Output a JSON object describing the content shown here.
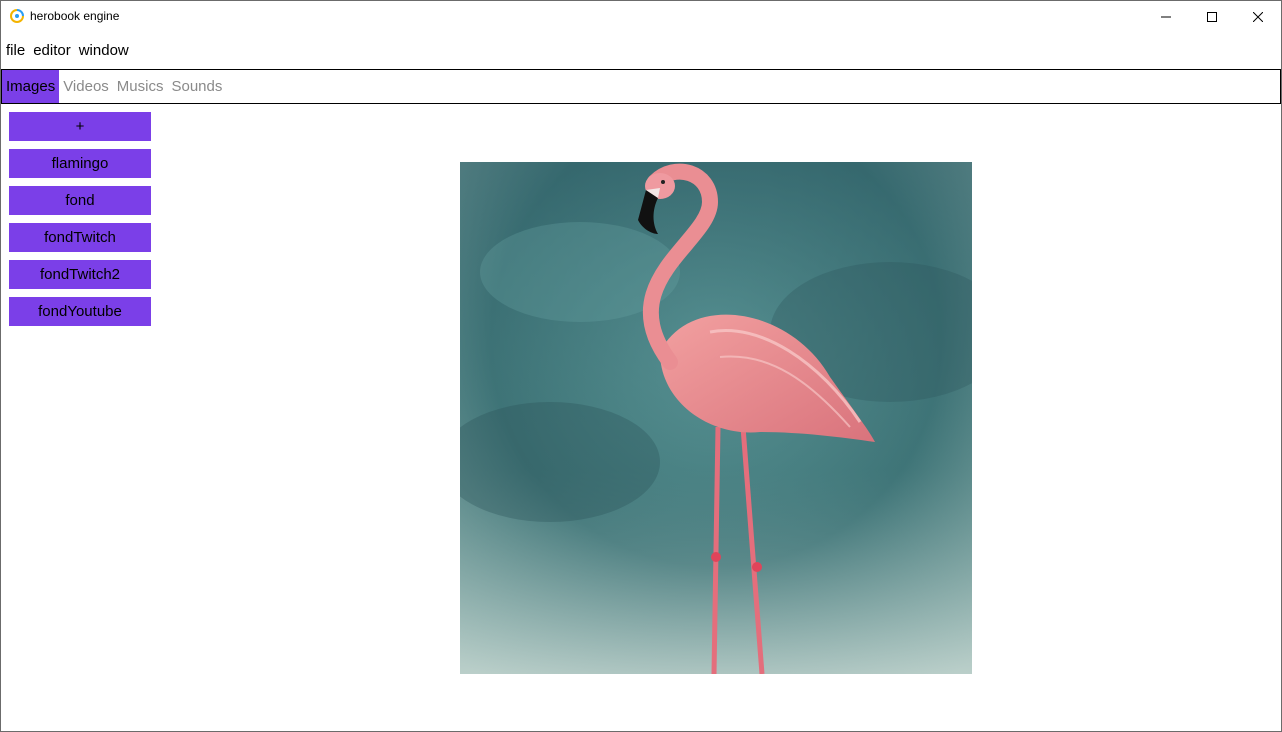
{
  "window": {
    "title": "herobook engine",
    "controls": {
      "minimize_icon": "minimize-icon",
      "maximize_icon": "maximize-icon",
      "close_icon": "close-icon"
    }
  },
  "menu": {
    "items": [
      "file",
      "editor",
      "window"
    ]
  },
  "tabs": {
    "items": [
      "Images",
      "Videos",
      "Musics",
      "Sounds"
    ],
    "active": "Images"
  },
  "sidebar": {
    "add_label": "+",
    "assets": [
      "flamingo",
      "fond",
      "fondTwitch",
      "fondTwitch2",
      "fondYoutube"
    ]
  },
  "colors": {
    "accent": "#7b3fe8",
    "preview_background": "#3f7a7c",
    "flamingo_pink": "#e98a8e"
  }
}
